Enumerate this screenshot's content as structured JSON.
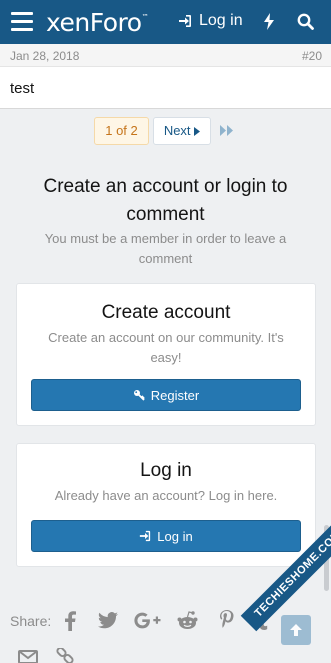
{
  "header": {
    "logo_text": "xenForo",
    "logo_mark": "™",
    "login_label": "Log in"
  },
  "post": {
    "date": "Jan 28, 2018",
    "number": "#20",
    "body": "test"
  },
  "pagination": {
    "current": "1 of 2",
    "next_label": "Next"
  },
  "comment_block": {
    "title": "Create an account or login to comment",
    "subtitle": "You must be a member in order to leave a comment"
  },
  "create_card": {
    "title": "Create account",
    "description": "Create an account on our community. It's easy!",
    "button_label": "Register"
  },
  "login_card": {
    "title": "Log in",
    "description": "Already have an account? Log in here.",
    "button_label": "Log in"
  },
  "share": {
    "label": "Share:",
    "icons": [
      "facebook-icon",
      "twitter-icon",
      "google-plus-icon",
      "reddit-icon",
      "pinterest-icon",
      "tumblr-icon",
      "email-icon",
      "link-icon"
    ]
  },
  "watermark": "TECHIESHOME.COM",
  "colors": {
    "header_bg": "#185886",
    "button_bg": "#2577b1",
    "page_current_text": "#c5741a"
  }
}
